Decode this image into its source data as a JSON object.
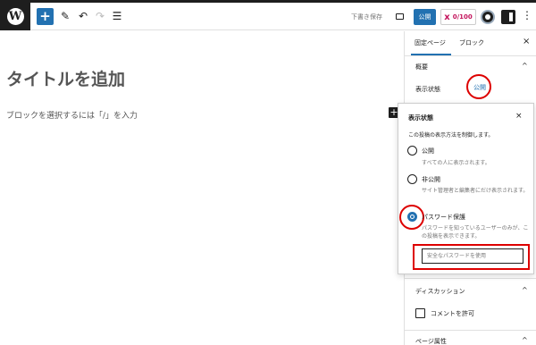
{
  "header": {
    "draft_label": "下書き保存",
    "publish_label": "公開",
    "yoast_score": "0/100",
    "more_glyph": "⋮",
    "add_glyph": "+"
  },
  "editor": {
    "title_placeholder": "タイトルを追加",
    "block_hint": "ブロックを選択するには「/」を入力",
    "inline_add": "+"
  },
  "sidebar": {
    "tabs": [
      "固定ページ",
      "ブロック"
    ],
    "active_tab": "固定ページ",
    "close_glyph": "×",
    "summary_heading": "概要",
    "visibility_label": "表示状態",
    "visibility_value": "公開",
    "discussion_heading": "ディスカッション",
    "allow_comments_label": "コメントを許可",
    "page_attributes_heading": "ページ属性"
  },
  "popover": {
    "title": "表示状態",
    "close_glyph": "×",
    "description": "この投稿の表示方法を制御します。",
    "options": [
      {
        "label": "公開",
        "desc": "すべての人に表示されます。",
        "checked": false
      },
      {
        "label": "非公開",
        "desc": "サイト管理者と編集者にだけ表示されます。",
        "checked": false
      },
      {
        "label": "パスワード保護",
        "desc": "パスワードを知っているユーザーのみが、この投稿を表示できます。",
        "checked": true
      }
    ],
    "password_placeholder": "安全なパスワードを使用"
  },
  "colors": {
    "accent": "#2271b1",
    "annotation_red": "#dd0000",
    "dark": "#1e1e1e"
  }
}
